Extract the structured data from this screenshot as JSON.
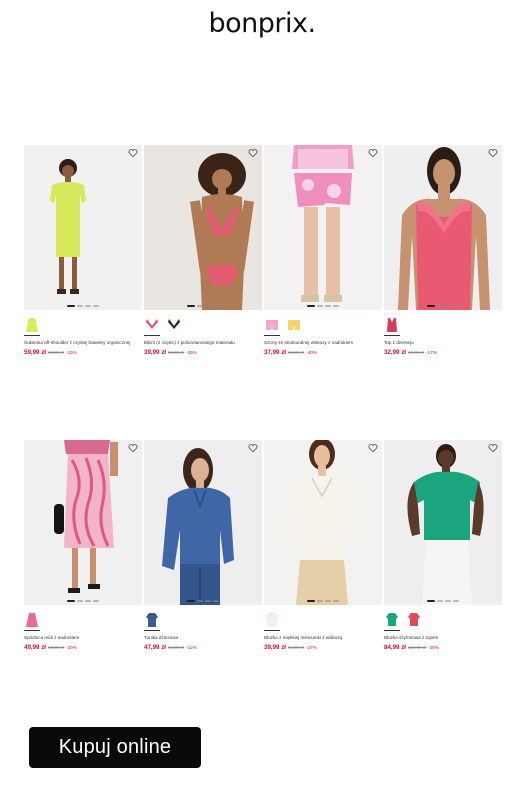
{
  "brand": {
    "logo_text": "bonprix."
  },
  "cta": {
    "label": "Kupuj online"
  },
  "products": [
    {
      "name": "Sukienka off-shoulder z czystej bawełny organicznej",
      "price": "59,99 zł",
      "old_price": "69,99 zł",
      "discount": "-15%",
      "swatch_colors": [
        "#d9ea5a"
      ],
      "icon": "dress-icon"
    },
    {
      "name": "Bikini (2 części) z poliuretanowego materiału",
      "price": "39,99 zł",
      "old_price": "59,99 zł",
      "discount": "-35%",
      "swatch_colors": [
        "#e0536a",
        "#1e2a4a"
      ],
      "icon": "bikini-icon"
    },
    {
      "name": "Szorty ze strukturalnej wiskozy z nadrukiem",
      "price": "37,99 zł",
      "old_price": "64,99 zł",
      "discount": "-40%",
      "swatch_colors": [
        "#f2a6c9",
        "#f3d56a"
      ],
      "icon": "shorts-icon"
    },
    {
      "name": "Top z dżerseju",
      "price": "32,99 zł",
      "old_price": "39,99 zł",
      "discount": "-17%",
      "swatch_colors": [
        "#d63c5c"
      ],
      "icon": "top-icon"
    },
    {
      "name": "Spódnica midi z nadrukiem",
      "price": "49,99 zł",
      "old_price": "59,99 zł",
      "discount": "-20%",
      "swatch_colors": [
        "#e86b96"
      ],
      "icon": "skirt-icon"
    },
    {
      "name": "Tunika dżinsowa",
      "price": "47,99 zł",
      "old_price": "54,99 zł",
      "discount": "-12%",
      "swatch_colors": [
        "#3c5a8c"
      ],
      "icon": "tunic-icon"
    },
    {
      "name": "Bluzka z miękkiej mieszanki z wiskozą",
      "price": "39,99 zł",
      "old_price": "54,99 zł",
      "discount": "-27%",
      "swatch_colors": [
        "#f4f1ea"
      ],
      "icon": "blouse-icon"
    },
    {
      "name": "Bluzka szyfonowa z topem",
      "price": "84,99 zł",
      "old_price": "119,99 zł",
      "discount": "-30%",
      "swatch_colors": [
        "#1aa57f",
        "#e14a5a"
      ],
      "icon": "blouse-icon"
    }
  ]
}
